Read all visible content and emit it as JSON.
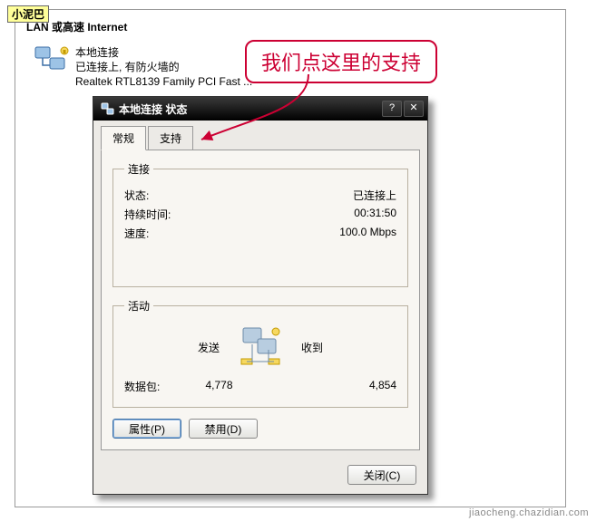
{
  "outer_label": "小泥巴",
  "heading": "LAN 或高速 Internet",
  "connection": {
    "name": "本地连接",
    "status_line": "已连接上, 有防火墙的",
    "adapter": "Realtek RTL8139 Family PCI Fast ..."
  },
  "callout_text": "我们点这里的支持",
  "dialog": {
    "title": "本地连接 状态",
    "tabs": {
      "general": "常规",
      "support": "支持"
    },
    "section_connection": {
      "legend": "连接",
      "status_label": "状态:",
      "status_value": "已连接上",
      "duration_label": "持续时间:",
      "duration_value": "00:31:50",
      "speed_label": "速度:",
      "speed_value": "100.0 Mbps"
    },
    "section_activity": {
      "legend": "活动",
      "sent_label": "发送",
      "recv_label": "收到",
      "packets_label": "数据包:",
      "sent_value": "4,778",
      "recv_value": "4,854"
    },
    "buttons": {
      "properties": "属性(P)",
      "disable": "禁用(D)",
      "close": "关闭(C)"
    }
  },
  "watermark": "jiaocheng.chazidian.com"
}
